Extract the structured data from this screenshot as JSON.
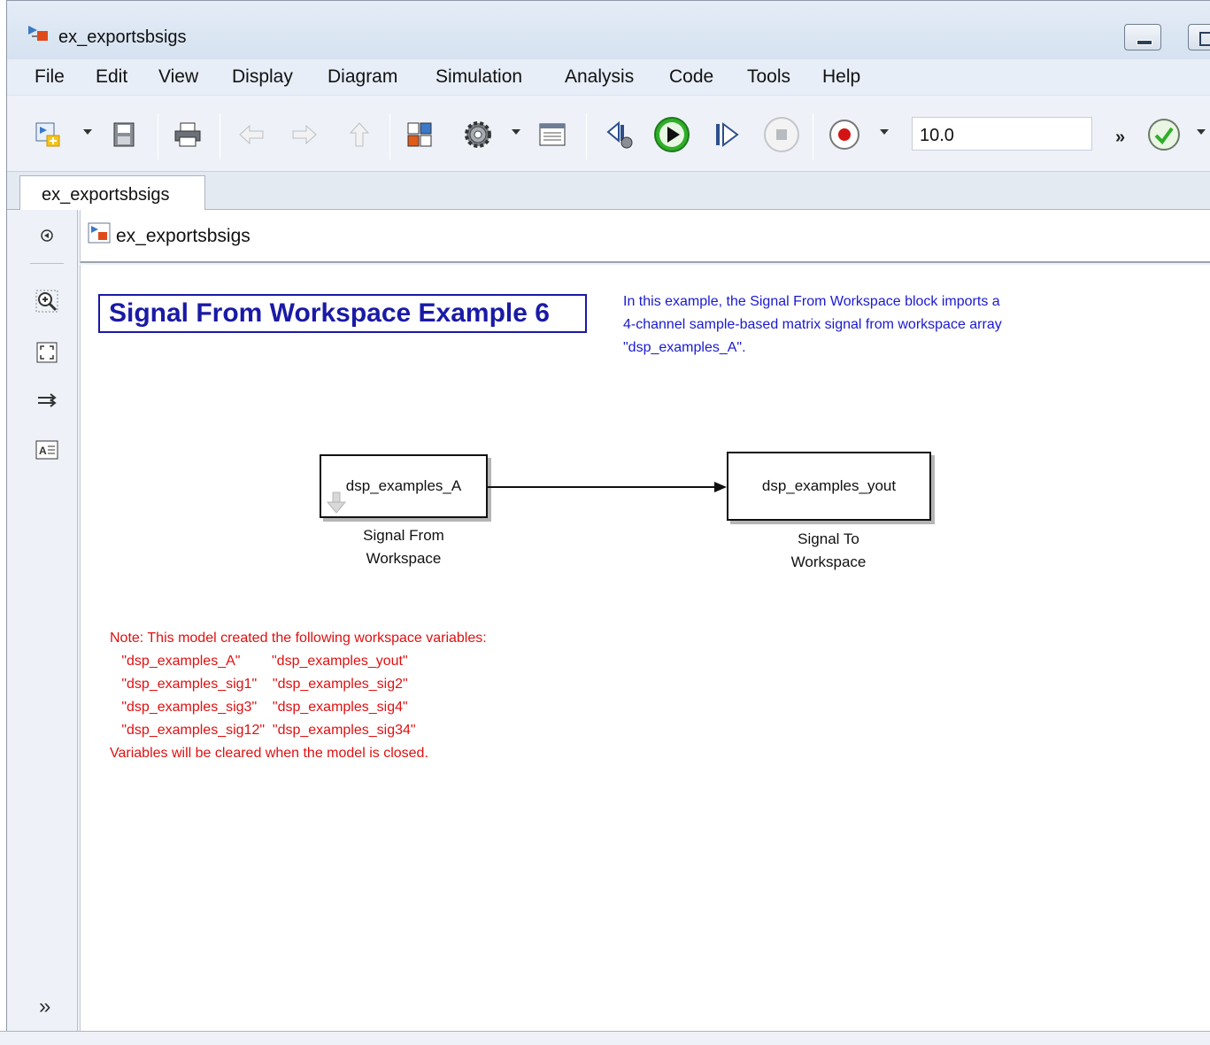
{
  "window": {
    "title": "ex_exportsbsigs"
  },
  "menubar": {
    "items": [
      "File",
      "Edit",
      "View",
      "Display",
      "Diagram",
      "Simulation",
      "Analysis",
      "Code",
      "Tools",
      "Help"
    ]
  },
  "toolbar": {
    "stop_time": "10.0",
    "more": "»"
  },
  "tabs": {
    "active": "ex_exportsbsigs"
  },
  "address": {
    "path": "ex_exportsbsigs"
  },
  "palette": {
    "expand": "»"
  },
  "diagram": {
    "title": "Signal From Workspace Example 6",
    "description": [
      "In this example, the Signal From Workspace block imports a",
      "4-channel sample-based matrix signal from workspace array",
      "\"dsp_examples_A\"."
    ],
    "blocks": {
      "source": {
        "text": "dsp_examples_A",
        "label_line1": "Signal From",
        "label_line2": "Workspace"
      },
      "sink": {
        "text": "dsp_examples_yout",
        "label_line1": "Signal To",
        "label_line2": "Workspace"
      }
    },
    "note": [
      "Note: This model created the following workspace variables:",
      "   \"dsp_examples_A\"        \"dsp_examples_yout\"",
      "   \"dsp_examples_sig1\"    \"dsp_examples_sig2\"",
      "   \"dsp_examples_sig3\"    \"dsp_examples_sig4\"",
      "   \"dsp_examples_sig12\"  \"dsp_examples_sig34\"",
      "Variables will be cleared when the model is closed."
    ]
  },
  "colors": {
    "title_blue": "#1a1aa6",
    "description_blue": "#1a1ad0",
    "note_red": "#e01010",
    "run_green": "#2fae2a",
    "record_red": "#d41414"
  }
}
